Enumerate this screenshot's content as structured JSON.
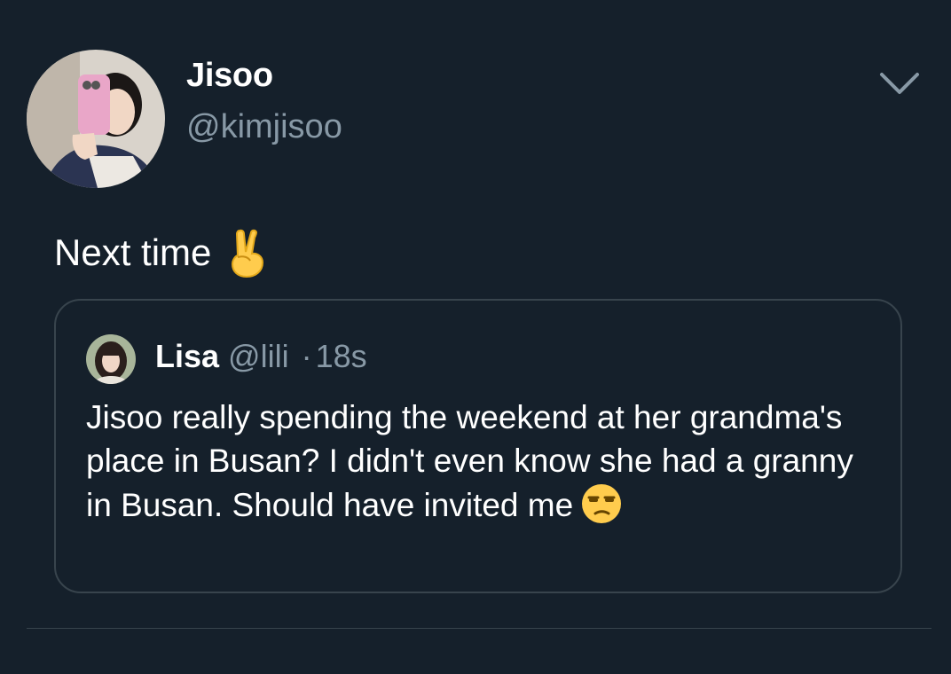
{
  "author": {
    "display_name": "Jisoo",
    "handle": "@kimjisoo",
    "avatar_icon": "profile-photo"
  },
  "tweet": {
    "text": "Next time",
    "emoji": "victory-hand-emoji"
  },
  "menu_icon": "chevron-down-icon",
  "quote": {
    "display_name": "Lisa",
    "handle": "@lili",
    "separator": "·",
    "time": "18s",
    "text": "Jisoo really spending the weekend at her grandma's place in Busan? I didn't even know she had a granny in Busan. Should have invited me",
    "emoji": "unamused-face-emoji"
  },
  "colors": {
    "background": "#15202b",
    "secondary_text": "#8899a6",
    "border": "#38444d"
  }
}
